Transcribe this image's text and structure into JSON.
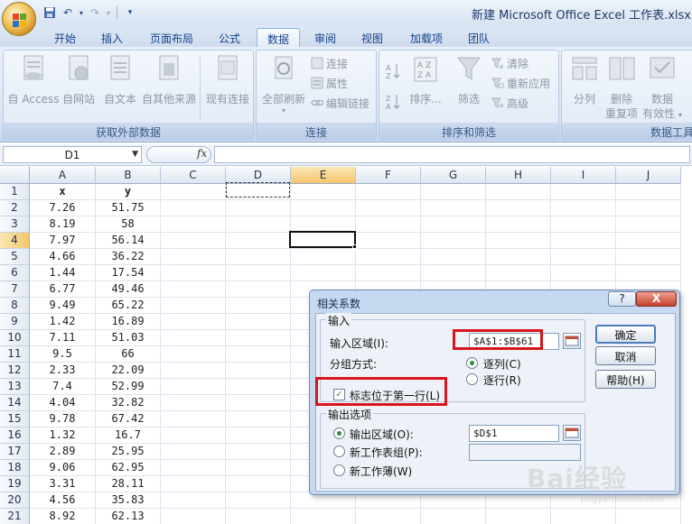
{
  "window": {
    "title": "新建 Microsoft Office Excel 工作表.xlsx - M"
  },
  "tabs": [
    {
      "label": "开始"
    },
    {
      "label": "插入"
    },
    {
      "label": "页面布局"
    },
    {
      "label": "公式"
    },
    {
      "label": "数据",
      "active": true
    },
    {
      "label": "审阅"
    },
    {
      "label": "视图"
    },
    {
      "label": "加载项"
    },
    {
      "label": "团队"
    }
  ],
  "ribbon": {
    "external": {
      "label": "获取外部数据",
      "access": "自 Access",
      "web": "自网站",
      "text": "自文本",
      "other": "自其他来源",
      "existing": "现有连接"
    },
    "connections": {
      "label": "连接",
      "refresh": "全部刷新",
      "connections": "连接",
      "properties": "属性",
      "edit_links": "编辑链接"
    },
    "sort_filter": {
      "label": "排序和筛选",
      "sort": "排序...",
      "filter": "筛选",
      "clear": "清除",
      "reapply": "重新应用",
      "advanced": "高级"
    },
    "data_tools": {
      "label": "数据工具",
      "split": "分列",
      "remove_dup_1": "删除",
      "remove_dup_2": "重复项",
      "validation_1": "数据",
      "validation_2": "有效性"
    }
  },
  "formula_bar": {
    "name_box": "D1",
    "fx": "fx"
  },
  "columns": [
    "A",
    "B",
    "C",
    "D",
    "E",
    "F",
    "G",
    "H",
    "I",
    "J"
  ],
  "rows": [
    [
      "x",
      "y"
    ],
    [
      "7.26",
      "51.75"
    ],
    [
      "8.19",
      "58"
    ],
    [
      "7.97",
      "56.14"
    ],
    [
      "4.66",
      "36.22"
    ],
    [
      "1.44",
      "17.54"
    ],
    [
      "6.77",
      "49.46"
    ],
    [
      "9.49",
      "65.22"
    ],
    [
      "1.42",
      "16.89"
    ],
    [
      "7.11",
      "51.03"
    ],
    [
      "9.5",
      "66"
    ],
    [
      "2.33",
      "22.09"
    ],
    [
      "7.4",
      "52.99"
    ],
    [
      "4.04",
      "32.82"
    ],
    [
      "9.78",
      "67.42"
    ],
    [
      "1.32",
      "16.7"
    ],
    [
      "2.89",
      "25.95"
    ],
    [
      "9.06",
      "62.95"
    ],
    [
      "3.31",
      "28.11"
    ],
    [
      "4.56",
      "35.83"
    ],
    [
      "8.92",
      "62.13"
    ]
  ],
  "dialog": {
    "title": "相关系数",
    "help": "?",
    "close": "X",
    "input_legend": "输入",
    "input_range_label": "输入区域(I):",
    "input_range_value": "$A$1:$B$61",
    "group_by_label": "分组方式:",
    "by_column": "逐列(C)",
    "by_row": "逐行(R)",
    "labels_first_row": "标志位于第一行(L)",
    "output_legend": "输出选项",
    "output_range_label": "输出区域(O):",
    "output_range_value": "$D$1",
    "new_sheet_label": "新工作表组(P):",
    "new_workbook_label": "新工作薄(W)",
    "ok": "确定",
    "cancel": "取消",
    "help_btn": "帮助(H)"
  },
  "watermark": {
    "text": "Bai经验",
    "sub": "jingyan.baidu.com"
  }
}
